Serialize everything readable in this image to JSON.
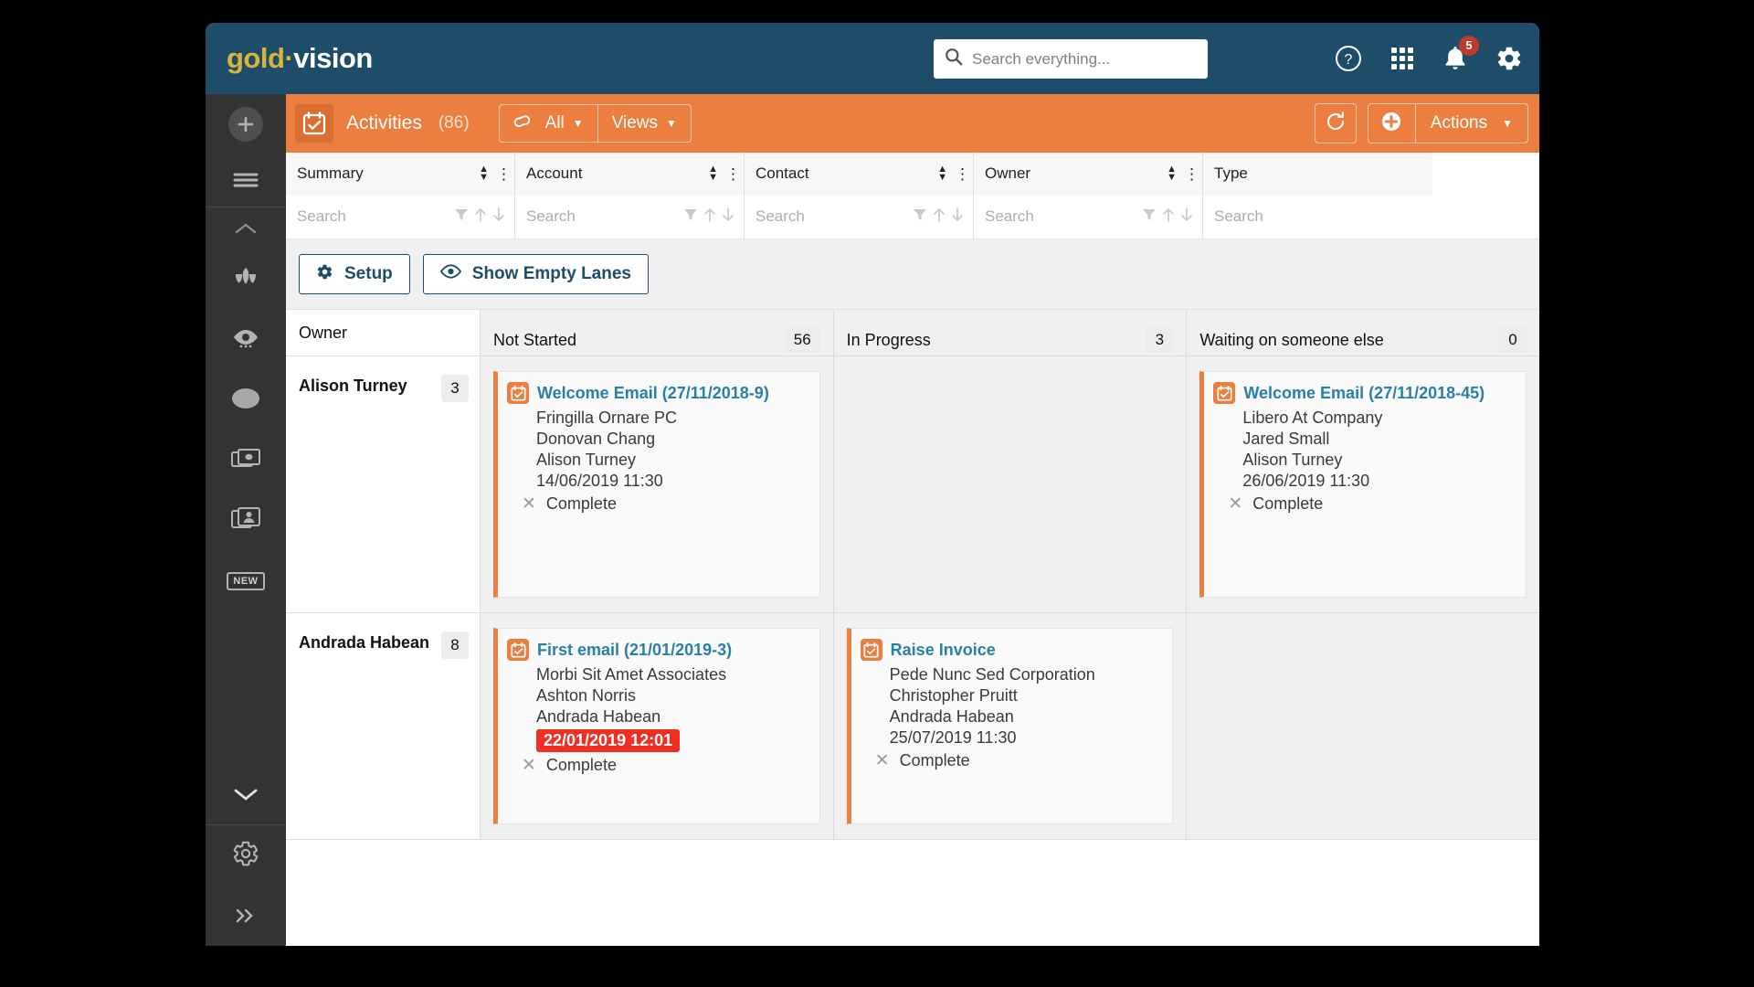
{
  "brand": {
    "name_gold": "gold",
    "dash": "·",
    "name_vision": "vision"
  },
  "header": {
    "search": {
      "placeholder": "Search everything...",
      "value": "",
      "icon": "search-icon"
    },
    "icons": [
      {
        "name": "help-icon",
        "label": "?"
      },
      {
        "name": "apps-grid-icon",
        "label": ""
      },
      {
        "name": "notifications-bell-icon",
        "label": "",
        "badge": "5"
      },
      {
        "name": "settings-gear-icon",
        "label": ""
      }
    ]
  },
  "rail": {
    "add_icon": "plus-icon",
    "menu_icon": "hamburger-menu-icon",
    "collapse_up_icon": "chevron-up-icon",
    "items": [
      {
        "icon": "tulip-flower-icon",
        "name": "rail-item-campaigns"
      },
      {
        "icon": "eye-icon",
        "name": "rail-item-views"
      },
      {
        "icon": "circle-icon",
        "name": "rail-item-circle"
      },
      {
        "icon": "banknotes-icon",
        "name": "rail-item-invoices"
      },
      {
        "icon": "contact-card-icon",
        "name": "rail-item-contacts"
      },
      {
        "icon": "new-badge-icon",
        "name": "rail-item-new",
        "label": "NEW"
      }
    ],
    "expand_down_icon": "chevron-down-icon",
    "settings_icon": "gear-icon",
    "expand_icon": "chevron-double-right-icon"
  },
  "module": {
    "icon": "calendar-check-icon",
    "title": "Activities",
    "count": "(86)",
    "filter": {
      "icon": "infinity-icon",
      "label": "All",
      "caret": "▼"
    },
    "views": {
      "label": "Views",
      "caret": "▼"
    },
    "refresh_icon": "refresh-icon",
    "actions": {
      "plus_icon": "plus-circle-icon",
      "label": "Actions",
      "caret": "▼"
    }
  },
  "columns": [
    {
      "label": "Summary",
      "search_placeholder": "Search"
    },
    {
      "label": "Account",
      "search_placeholder": "Search"
    },
    {
      "label": "Contact",
      "search_placeholder": "Search"
    },
    {
      "label": "Owner",
      "search_placeholder": "Search"
    },
    {
      "label": "Type",
      "search_placeholder": "Search"
    }
  ],
  "column_icons": {
    "sort_icon": "sort-arrows-icon",
    "kebab_icon": "kebab-menu-icon",
    "filter_icon": "funnel-filter-icon",
    "sort_asc_icon": "arrow-up-icon",
    "sort_desc_icon": "arrow-down-icon"
  },
  "toolbar": {
    "setup_label": "Setup",
    "setup_icon": "gear-icon",
    "show_empty_lanes_label": "Show Empty Lanes",
    "show_empty_lanes_icon": "eye-icon"
  },
  "kanban": {
    "owner_header": "Owner",
    "lanes": [
      {
        "label": "Not Started",
        "count": "56"
      },
      {
        "label": "In Progress",
        "count": "3"
      },
      {
        "label": "Waiting on someone else",
        "count": "0"
      }
    ],
    "rows": [
      {
        "owner": "Alison Turney",
        "owner_count": "3",
        "cells": [
          {
            "card": {
              "icon": "calendar-check-icon",
              "title": "Welcome Email (27/11/2018-9)",
              "account": "Fringilla Ornare PC",
              "contact": "Donovan Chang",
              "owner": "Alison Turney",
              "date": "14/06/2019 11:30",
              "date_alert": false,
              "status_label": "Complete",
              "status_icon": "x-mark-icon"
            }
          },
          {
            "card": null
          },
          {
            "card": {
              "icon": "calendar-check-icon",
              "title": "Welcome Email (27/11/2018-45)",
              "account": "Libero At Company",
              "contact": "Jared Small",
              "owner": "Alison Turney",
              "date": "26/06/2019 11:30",
              "date_alert": false,
              "status_label": "Complete",
              "status_icon": "x-mark-icon"
            }
          }
        ]
      },
      {
        "owner": "Andrada Habean",
        "owner_count": "8",
        "cells": [
          {
            "card": {
              "icon": "calendar-check-icon",
              "title": "First email (21/01/2019-3)",
              "account": "Morbi Sit Amet Associates",
              "contact": "Ashton Norris",
              "owner": "Andrada Habean",
              "date": "22/01/2019 12:01",
              "date_alert": true,
              "status_label": "Complete",
              "status_icon": "x-mark-icon"
            }
          },
          {
            "card": {
              "icon": "calendar-check-icon",
              "title": "Raise Invoice",
              "account": "Pede Nunc Sed Corporation",
              "contact": "Christopher Pruitt",
              "owner": "Andrada Habean",
              "date": "25/07/2019 11:30",
              "date_alert": false,
              "status_label": "Complete",
              "status_icon": "x-mark-icon"
            }
          },
          {
            "card": null
          }
        ]
      }
    ]
  },
  "colors": {
    "brand_navy": "#1d4d69",
    "brand_orange": "#ec7f40",
    "rail_dark": "#333333",
    "alert_red": "#ef2f22",
    "link_blue": "#2980a5",
    "gold": "#d9b43c"
  }
}
